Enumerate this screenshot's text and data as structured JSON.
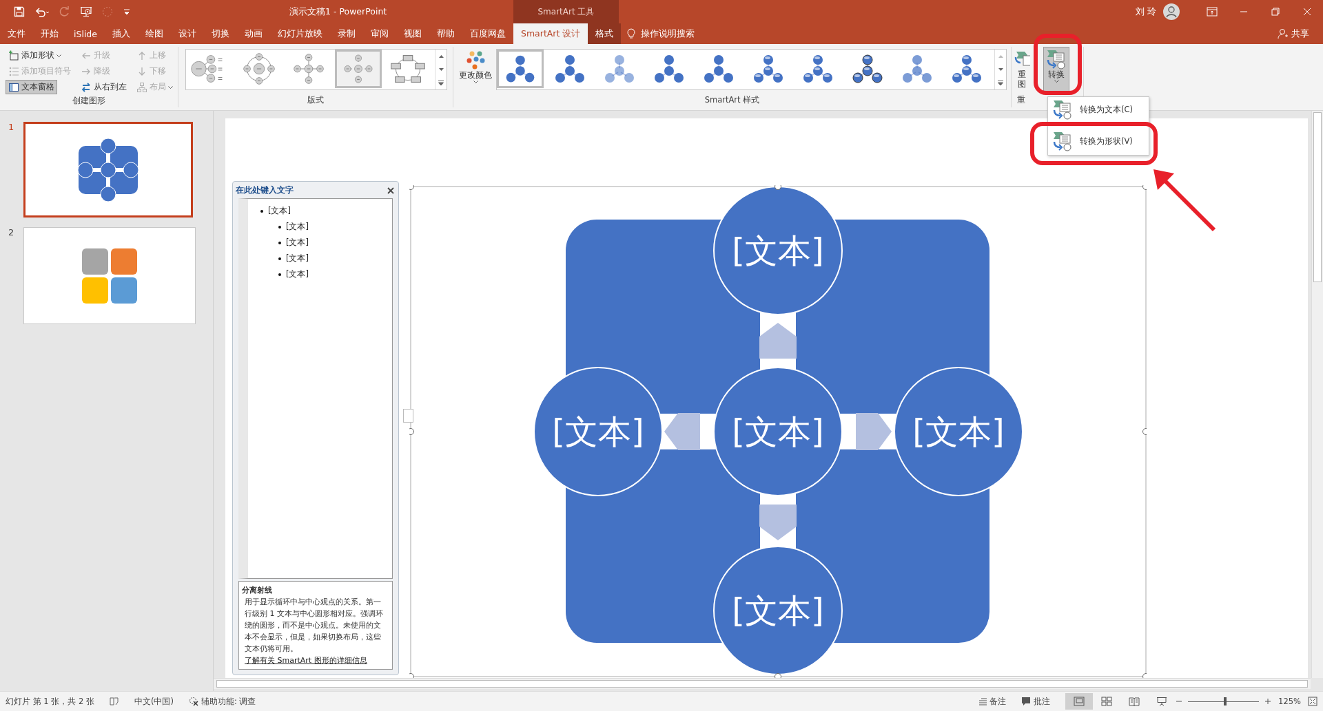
{
  "window": {
    "title": "演示文稿1  -  PowerPoint",
    "context_group": "SmartArt 工具",
    "user": "刘 玲"
  },
  "tabs": [
    {
      "label": "文件",
      "selected": false,
      "contextual": false
    },
    {
      "label": "开始",
      "selected": false,
      "contextual": false
    },
    {
      "label": "iSlide",
      "selected": false,
      "contextual": false
    },
    {
      "label": "插入",
      "selected": false,
      "contextual": false
    },
    {
      "label": "绘图",
      "selected": false,
      "contextual": false
    },
    {
      "label": "设计",
      "selected": false,
      "contextual": false
    },
    {
      "label": "切换",
      "selected": false,
      "contextual": false
    },
    {
      "label": "动画",
      "selected": false,
      "contextual": false
    },
    {
      "label": "幻灯片放映",
      "selected": false,
      "contextual": false
    },
    {
      "label": "录制",
      "selected": false,
      "contextual": false
    },
    {
      "label": "审阅",
      "selected": false,
      "contextual": false
    },
    {
      "label": "视图",
      "selected": false,
      "contextual": false
    },
    {
      "label": "帮助",
      "selected": false,
      "contextual": false
    },
    {
      "label": "百度网盘",
      "selected": false,
      "contextual": false
    },
    {
      "label": "SmartArt 设计",
      "selected": true,
      "contextual": true
    },
    {
      "label": "格式",
      "selected": false,
      "contextual": true
    }
  ],
  "tell_me": "操作说明搜索",
  "share": "共享",
  "create_graphic": {
    "label": "创建图形",
    "buttons": [
      {
        "kind": "addshape",
        "label": "添加形状",
        "disabled": false,
        "pressed": false,
        "dropdown": true
      },
      {
        "kind": "addbullet",
        "label": "添加项目符号",
        "disabled": true,
        "pressed": false,
        "dropdown": false
      },
      {
        "kind": "textpane",
        "label": "文本窗格",
        "disabled": false,
        "pressed": true,
        "dropdown": false
      },
      {
        "kind": "promote",
        "label": "升级",
        "disabled": true,
        "pressed": false,
        "dropdown": false
      },
      {
        "kind": "demote",
        "label": "降级",
        "disabled": true,
        "pressed": false,
        "dropdown": false
      },
      {
        "kind": "rtl",
        "label": "从右到左",
        "disabled": false,
        "pressed": false,
        "dropdown": false
      },
      {
        "kind": "up",
        "label": "上移",
        "disabled": true,
        "pressed": false,
        "dropdown": false
      },
      {
        "kind": "down",
        "label": "下移",
        "disabled": true,
        "pressed": false,
        "dropdown": false
      },
      {
        "kind": "layout",
        "label": "布局",
        "disabled": true,
        "pressed": false,
        "dropdown": true
      }
    ]
  },
  "layouts": {
    "label": "版式",
    "items": [
      {
        "selected": false
      },
      {
        "selected": false
      },
      {
        "selected": false
      },
      {
        "selected": true
      },
      {
        "selected": false
      }
    ]
  },
  "styles": {
    "change_color": "更改颜色",
    "label": "SmartArt 样式",
    "items": [
      {
        "selected": true
      },
      {
        "selected": false
      },
      {
        "selected": false
      },
      {
        "selected": false
      },
      {
        "selected": false
      },
      {
        "selected": false
      },
      {
        "selected": false
      },
      {
        "selected": false
      },
      {
        "selected": false
      },
      {
        "selected": false
      }
    ]
  },
  "reset": {
    "label_lines": [
      "重",
      "图"
    ],
    "group_label": "重"
  },
  "convert": {
    "label": "转换",
    "expanded": true
  },
  "convert_menu": [
    {
      "label": "转换为文本(C)"
    },
    {
      "label": "转换为形状(V)"
    }
  ],
  "slides": [
    {
      "number": "1",
      "selected": true,
      "kind": "radial"
    },
    {
      "number": "2",
      "selected": false,
      "kind": "matrix"
    }
  ],
  "text_pane": {
    "title": "在此处键入文字",
    "items": [
      {
        "text": "[文本]",
        "children": [
          {
            "text": "[文本]"
          },
          {
            "text": "[文本]"
          },
          {
            "text": "[文本]"
          },
          {
            "text": "[文本]"
          }
        ]
      }
    ],
    "description_title": "分离射线",
    "description": "用于显示循环中与中心观点的关系。第一行级别 1 文本与中心圆形相对应。强调环绕的圆形，而不是中心观点。未使用的文本不会显示，但是，如果切换布局，这些文本仍将可用。",
    "link": "了解有关 SmartArt 图形的详细信息"
  },
  "diagram": {
    "center": "[文本]",
    "satellites": [
      "[文本]",
      "[文本]",
      "[文本]",
      "[文本]"
    ]
  },
  "status_bar": {
    "slide_info": "幻灯片 第 1 张，共 2 张",
    "language": "中文(中国)",
    "accessibility": "辅助功能: 调查",
    "notes": "备注",
    "comments": "批注",
    "views": [
      {
        "selected": true
      },
      {
        "selected": false
      },
      {
        "selected": false
      },
      {
        "selected": false
      }
    ],
    "zoom_slider": {
      "level": 0.52
    },
    "zoom": "125%"
  }
}
